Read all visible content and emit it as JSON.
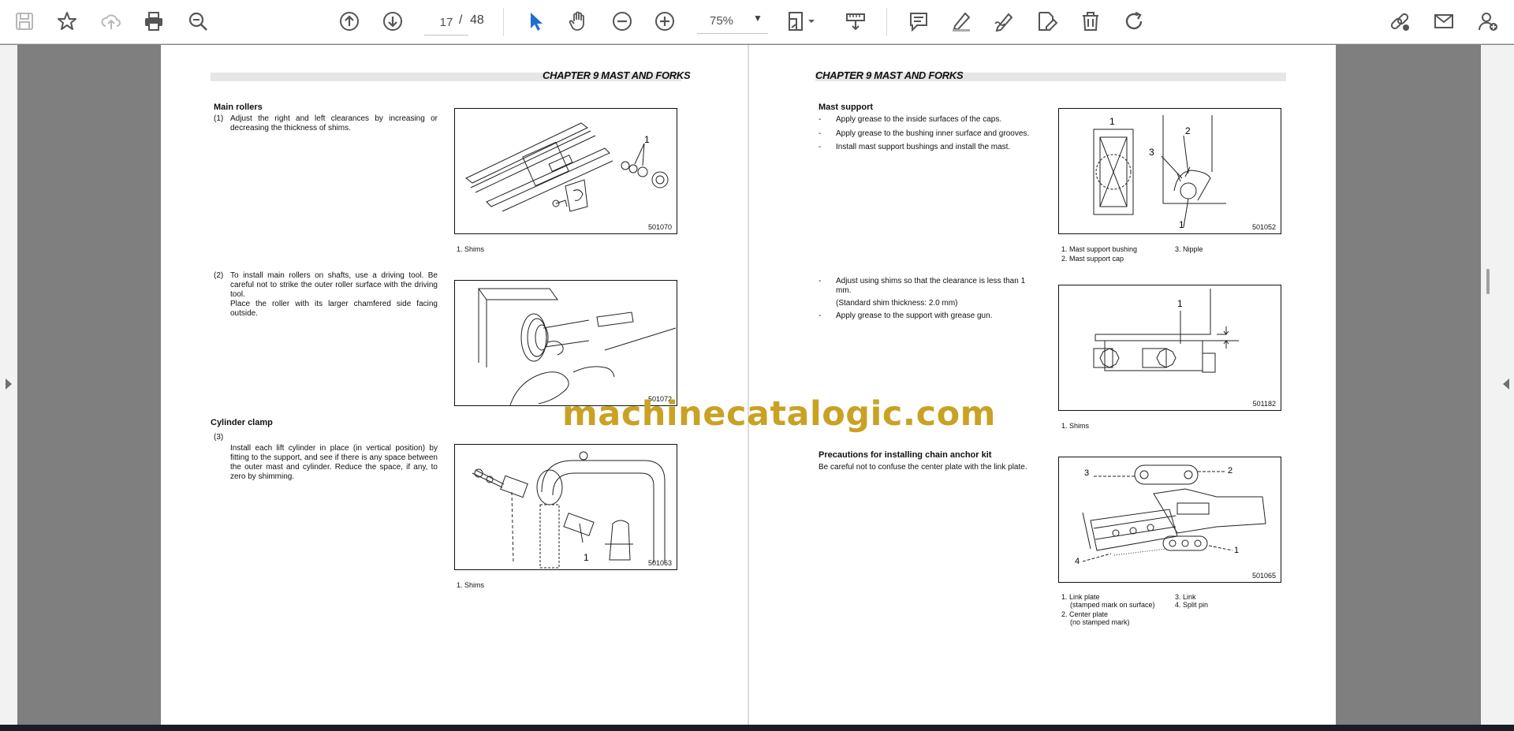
{
  "toolbar": {
    "page_current": "17",
    "page_separator": "/",
    "page_total": "48",
    "zoom": "75%",
    "accent_color": "#1f6fd1",
    "icons": [
      "save-icon",
      "bookmark-star-icon",
      "cloud-upload-icon",
      "print-icon",
      "zoom-search-icon",
      "page-up-icon",
      "page-down-icon",
      "select-cursor-icon",
      "hand-tool-icon",
      "zoom-out-icon",
      "zoom-in-icon",
      "fit-page-icon",
      "scroll-mode-icon",
      "comment-icon",
      "highlight-icon",
      "draw-icon",
      "fill-sign-icon",
      "delete-icon",
      "rotate-icon",
      "share-link-icon",
      "email-icon",
      "add-user-icon"
    ]
  },
  "left_page": {
    "header": "CHAPTER 9 MAST AND FORKS",
    "main_rollers": {
      "title": "Main rollers",
      "step1_num": "(1)",
      "step1_text": "Adjust the right and left clearances by increasing or decreasing the thickness of shims.",
      "fig1_code": "501070",
      "fig1_label": "1",
      "fig1_caption": "1. Shims",
      "step2_num": "(2)",
      "step2_text": "To install main rollers on shafts, use a driving tool. Be careful not to strike the outer roller surface with the driving tool.",
      "step2_text_b": "Place the roller with its larger chamfered side facing outside.",
      "fig2_code": "501072"
    },
    "cylinder_clamp": {
      "title": "Cylinder clamp",
      "step3_num": "(3)",
      "step3_text": "Install each lift cylinder in place (in vertical position) by fitting to the support, and see if there is any space between the outer mast and cylinder. Reduce the space, if any, to zero by shimming.",
      "fig3_code": "501063",
      "fig3_label": "1",
      "fig3_caption": "1. Shims"
    }
  },
  "right_page": {
    "header": "CHAPTER 9 MAST AND FORKS",
    "mast_support": {
      "title": "Mast support",
      "bullets": [
        "Apply grease to the inside surfaces of the caps.",
        "Apply grease to the bushing inner surface and grooves.",
        "Install mast support bushings and install the mast."
      ],
      "fig1_code": "501052",
      "fig1_labels": [
        "1",
        "2",
        "3",
        "1"
      ],
      "fig1_caption_a": "1. Mast support bushing",
      "fig1_caption_b": "2. Mast support cap",
      "fig1_caption_c": "3. Nipple",
      "bullets2": [
        "Adjust using shims so that the clearance is less than 1 mm.",
        "Apply grease to the support with grease gun."
      ],
      "bullets2_note": "(Standard shim thickness: 2.0 mm)",
      "fig2_code": "501182",
      "fig2_label": "1",
      "fig2_caption": "1. Shims"
    },
    "chain_anchor": {
      "title": "Precautions for installing chain anchor kit",
      "text": "Be careful not to confuse the center plate with the link plate.",
      "fig_code": "501065",
      "fig_labels": [
        "3",
        "2",
        "4",
        "1"
      ],
      "caption_1": "1. Link plate",
      "caption_1b": "(stamped mark on surface)",
      "caption_2": "2. Center plate",
      "caption_2b": "(no stamped mark)",
      "caption_3": "3. Link",
      "caption_4": "4. Split pin"
    }
  },
  "watermark": "machinecatalogic.com"
}
